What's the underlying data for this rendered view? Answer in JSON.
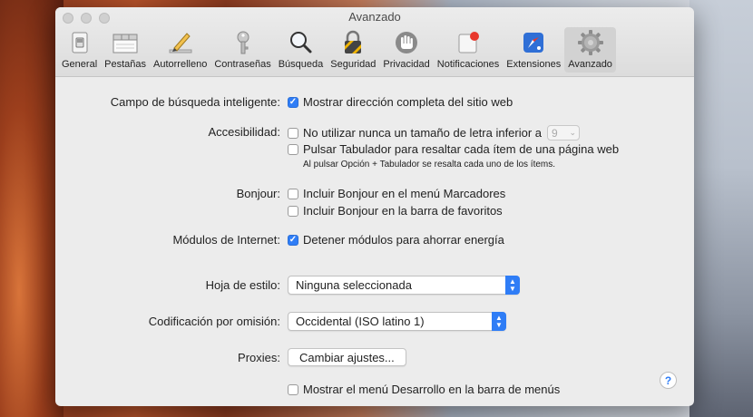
{
  "window": {
    "title": "Avanzado"
  },
  "toolbar": {
    "items": [
      {
        "label": "General",
        "icon": "general-switch-icon"
      },
      {
        "label": "Pestañas",
        "icon": "tabs-icon"
      },
      {
        "label": "Autorrelleno",
        "icon": "pencil-icon"
      },
      {
        "label": "Contraseñas",
        "icon": "key-icon"
      },
      {
        "label": "Búsqueda",
        "icon": "magnifier-icon"
      },
      {
        "label": "Seguridad",
        "icon": "padlock-icon"
      },
      {
        "label": "Privacidad",
        "icon": "hand-icon"
      },
      {
        "label": "Notificaciones",
        "icon": "notification-icon"
      },
      {
        "label": "Extensiones",
        "icon": "compass-icon"
      },
      {
        "label": "Avanzado",
        "icon": "gear-icon"
      }
    ],
    "active": "Avanzado"
  },
  "settings": {
    "smart_search": {
      "label": "Campo de búsqueda inteligente:",
      "option": "Mostrar dirección completa del sitio web",
      "checked": true
    },
    "accessibility": {
      "label": "Accesibilidad:",
      "option1": "No utilizar nunca un tamaño de letra inferior a",
      "option1_checked": false,
      "font_size_value": "9",
      "option2": "Pulsar Tabulador para resaltar cada ítem de una página web",
      "option2_checked": false,
      "note": "Al pulsar Opción + Tabulador se resalta cada uno de los ítems."
    },
    "bonjour": {
      "label": "Bonjour:",
      "option1": "Incluir Bonjour en el menú Marcadores",
      "option1_checked": false,
      "option2": "Incluir Bonjour en la barra de favoritos",
      "option2_checked": false
    },
    "plugins": {
      "label": "Módulos de Internet:",
      "option": "Detener módulos para ahorrar energía",
      "checked": true
    },
    "stylesheet": {
      "label": "Hoja de estilo:",
      "value": "Ninguna seleccionada"
    },
    "encoding": {
      "label": "Codificación por omisión:",
      "value": "Occidental (ISO latino 1)"
    },
    "proxies": {
      "label": "Proxies:",
      "button": "Cambiar ajustes..."
    },
    "develop_menu": {
      "option": "Mostrar el menú Desarrollo en la barra de menús",
      "checked": false
    }
  },
  "help": {
    "label": "?"
  },
  "colors": {
    "accent": "#2f7df6",
    "window_bg": "#ececec"
  }
}
